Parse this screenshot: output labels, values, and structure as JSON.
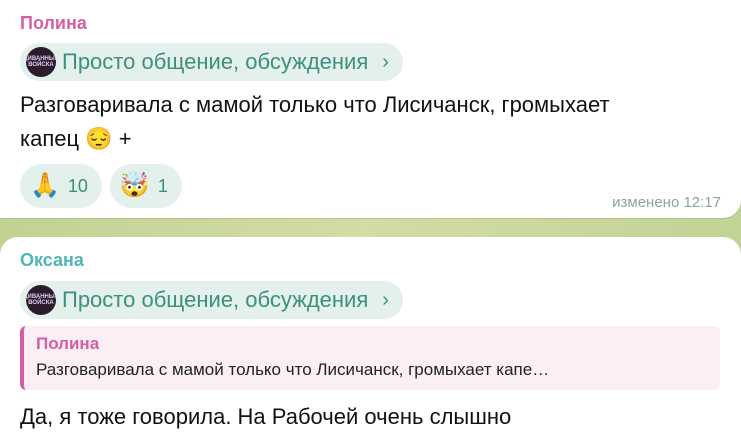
{
  "messages": [
    {
      "sender": "Полина",
      "topic": "Просто общение, обсуждения",
      "topic_avatar_text": "ДИВАННЫЕ ВОЙСКА",
      "text_line1": "Разговаривала с мамой только что Лисичанск, громыхает",
      "text_line2_prefix": "капец",
      "text_line2_emoji": "😔",
      "text_line2_suffix": "+",
      "reactions": [
        {
          "emoji": "🙏",
          "count": "10"
        },
        {
          "emoji": "🤯",
          "count": "1"
        }
      ],
      "meta": "изменено 12:17"
    },
    {
      "sender": "Оксана",
      "topic": "Просто общение, обсуждения",
      "topic_avatar_text": "ДИВАННЫЕ ВОЙСКА",
      "reply": {
        "name": "Полина",
        "text": "Разговаривала с мамой только что Лисичанск, громыхает капе…"
      },
      "text": "Да, я тоже говорила. На Рабочей очень слышно"
    }
  ]
}
